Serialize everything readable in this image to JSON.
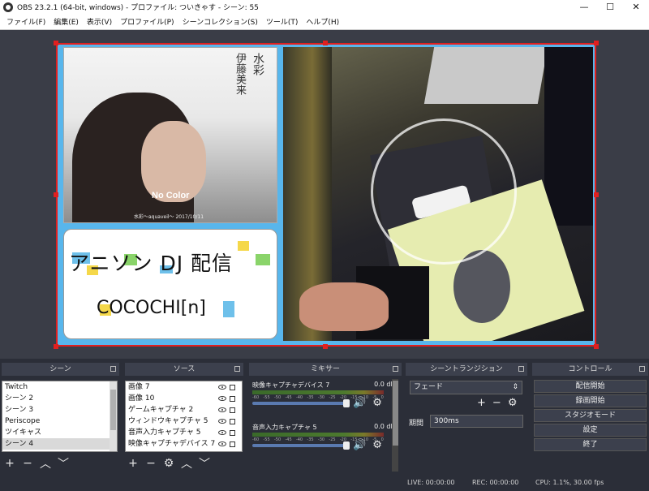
{
  "window": {
    "title": "OBS 23.2.1 (64-bit, windows) - プロファイル: ついきゃす - シーン: 55"
  },
  "menu": [
    "ファイル(F)",
    "編集(E)",
    "表示(V)",
    "プロファイル(P)",
    "シーンコレクション(S)",
    "ツール(T)",
    "ヘルプ(H)"
  ],
  "preview": {
    "photo_text_vertical1": "水彩",
    "photo_text_vertical2": "伊藤美来",
    "photo_nocolor": "No Color",
    "photo_caption": "水彩〜aquaveil〜 2017/10/11",
    "logo_line1": "アニソン DJ 配信",
    "logo_line2": "COCOCHI[n]"
  },
  "docks": {
    "scenes": {
      "title": "シーン",
      "items": [
        "Twitch",
        "シーン 2",
        "シーン 3",
        "Periscope",
        "ツイキャス",
        "シーン 4"
      ],
      "selected": "シーン 4"
    },
    "sources": {
      "title": "ソース",
      "items": [
        "画像 7",
        "画像 10",
        "ゲームキャプチャ 2",
        "ウィンドウキャプチャ 5",
        "音声入力キャプチャ 5",
        "映像キャプチャデバイス 7"
      ]
    },
    "mixer": {
      "title": "ミキサー",
      "tracks": [
        {
          "name": "映像キャプチャデバイス 7",
          "db": "0.0 dB"
        },
        {
          "name": "音声入力キャプチャ 5",
          "db": "0.0 dB"
        }
      ],
      "ticks": [
        "-60",
        "-55",
        "-50",
        "-45",
        "-40",
        "-35",
        "-30",
        "-25",
        "-20",
        "-15",
        "-10",
        "-5",
        "0"
      ]
    },
    "transitions": {
      "title": "シーントランジション",
      "selected": "フェード",
      "duration_label": "期間",
      "duration_value": "300ms"
    },
    "controls": {
      "title": "コントロール",
      "buttons": [
        "配信開始",
        "録画開始",
        "スタジオモード",
        "設定",
        "終了"
      ]
    }
  },
  "status": {
    "live": "LIVE: 00:00:00",
    "rec": "REC: 00:00:00",
    "cpu": "CPU: 1.1%, 30.00 fps"
  }
}
